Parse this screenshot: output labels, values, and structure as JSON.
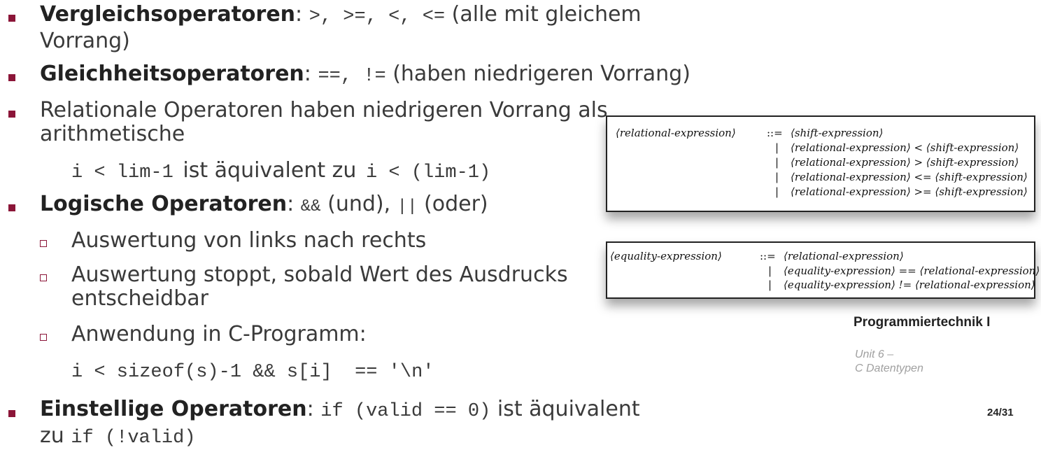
{
  "bullets": {
    "b1": {
      "bold": "Vergleichsoperatoren",
      "colon": ":",
      "ops": ">, >=, <, <=",
      "rest": "(alle mit gleichem",
      "line2": "Vorrang)"
    },
    "b2": {
      "bold": "Gleichheitsoperatoren",
      "colon": ":",
      "ops": "==, !=",
      "rest": "(haben niedrigeren Vorrang)"
    },
    "b3": {
      "line1": "Relationale Operatoren haben niedrigeren Vorrang als",
      "line2": "arithmetische"
    },
    "example1": {
      "code_a": "i < lim-1",
      "mid": "ist äquivalent zu",
      "code_b": "i < (lim-1)"
    },
    "b4": {
      "bold": "Logische Operatoren",
      "colon": ":",
      "op_and": "&&",
      "and_text": "(und),",
      "op_or": "||",
      "or_text": "(oder)"
    },
    "sub1": "Auswertung von links nach rechts",
    "sub2": {
      "line1": "Auswertung stoppt, sobald Wert des Ausdrucks",
      "line2": "entscheidbar"
    },
    "sub3": "Anwendung in C-Programm:",
    "example2": "i < sizeof(s)-1 && s[i]  == '\\n'",
    "b5": {
      "bold": "Einstellige Operatoren",
      "colon": ":",
      "code_a": "if (valid == 0)",
      "mid": "ist äquivalent",
      "line2_pre": "zu",
      "code_b": "if (!valid)"
    }
  },
  "grammar_relational": {
    "lhs": "⟨relational-expression⟩",
    "def": "::=",
    "rows": [
      {
        "sep": "",
        "rule": "⟨shift-expression⟩"
      },
      {
        "sep": "|",
        "rule": "⟨relational-expression⟩ < ⟨shift-expression⟩"
      },
      {
        "sep": "|",
        "rule": "⟨relational-expression⟩ > ⟨shift-expression⟩"
      },
      {
        "sep": "|",
        "rule": "⟨relational-expression⟩ <= ⟨shift-expression⟩"
      },
      {
        "sep": "|",
        "rule": "⟨relational-expression⟩ >= ⟨shift-expression⟩"
      }
    ]
  },
  "grammar_equality": {
    "lhs": "⟨equality-expression⟩",
    "def": "::=",
    "rows": [
      {
        "sep": "",
        "rule": "⟨relational-expression⟩"
      },
      {
        "sep": "|",
        "rule": "⟨equality-expression⟩ == ⟨relational-expression⟩"
      },
      {
        "sep": "|",
        "rule": "⟨equality-expression⟩ != ⟨relational-expression⟩"
      }
    ]
  },
  "sidebar": {
    "course": "Programmiertechnik I",
    "unit_line1": "Unit 6 –",
    "unit_line2": "C Datentypen"
  },
  "page_number": "24/31",
  "colors": {
    "accent": "#8b1538",
    "text": "#3a3a3a"
  }
}
